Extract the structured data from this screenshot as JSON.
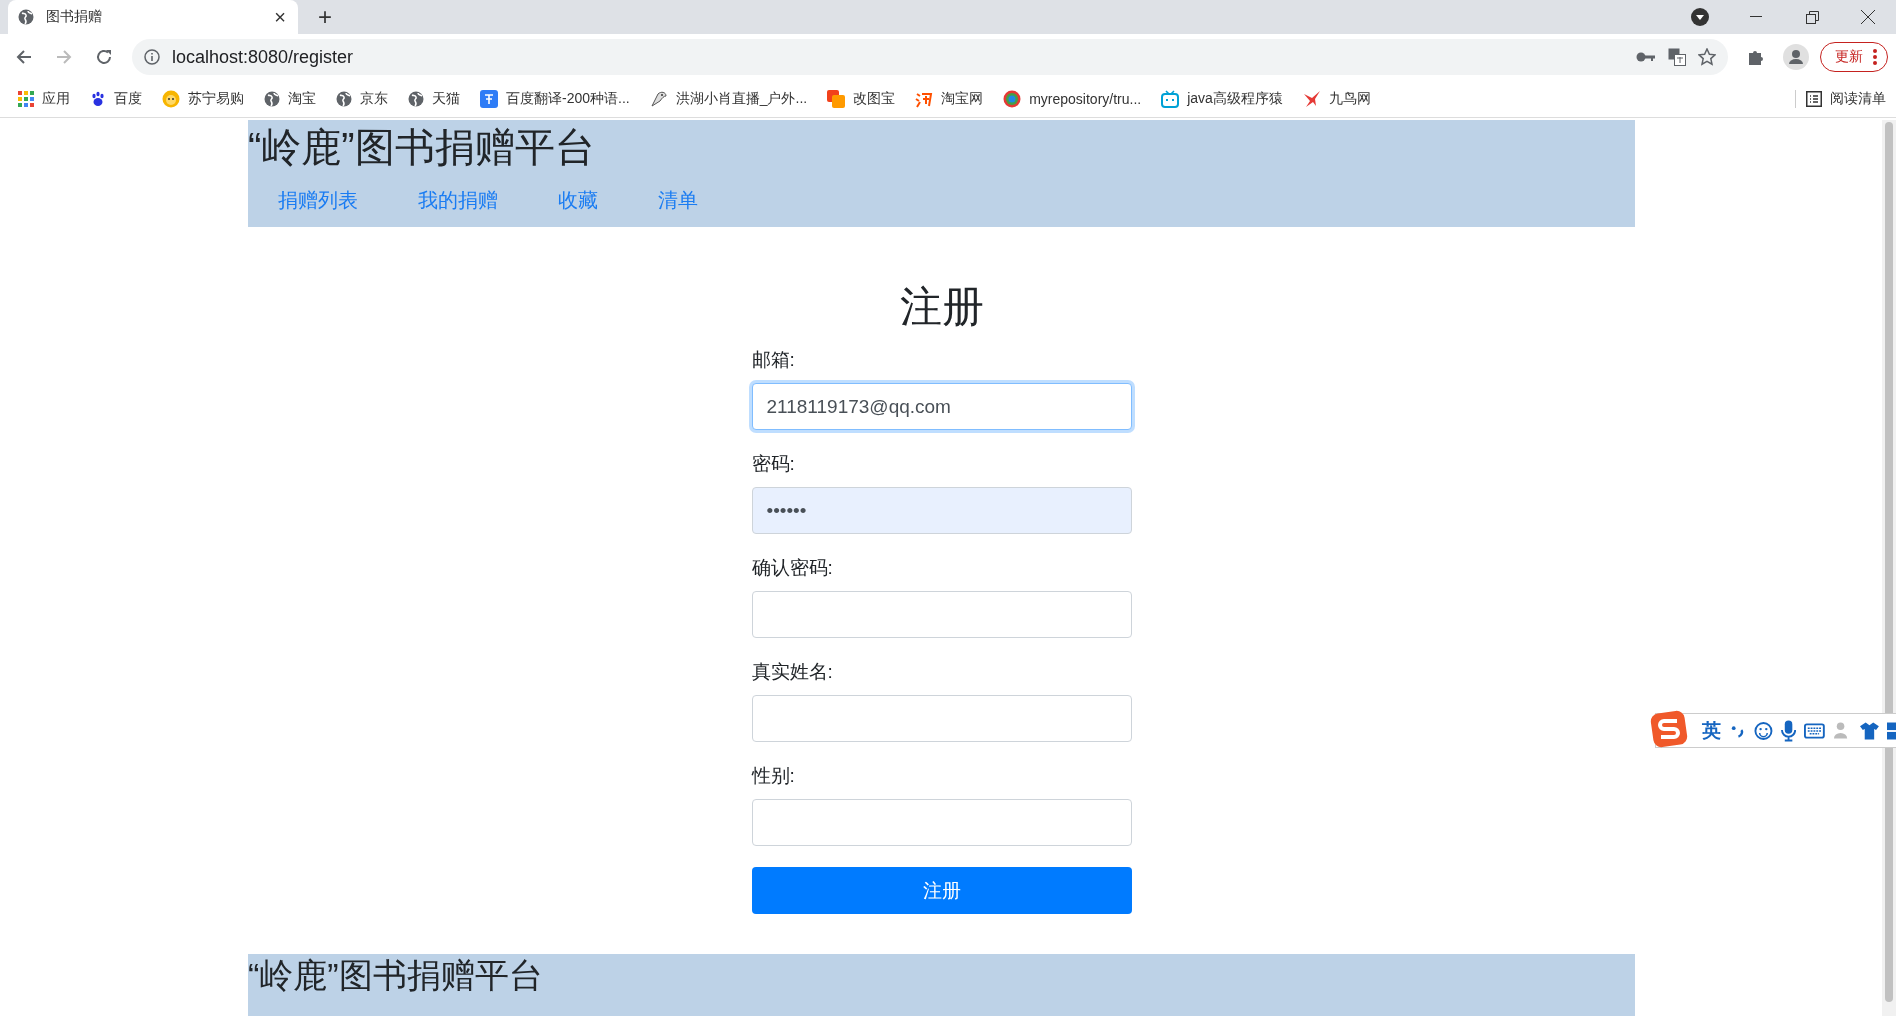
{
  "browser": {
    "tab_title": "图书捐赠",
    "tab_close": "×",
    "new_tab": "+",
    "address": "localhost:8080/register",
    "update_button": "更新",
    "bookmarks": [
      {
        "label": "应用",
        "kind": "apps"
      },
      {
        "label": "百度",
        "kind": "paw"
      },
      {
        "label": "苏宁易购",
        "kind": "lion"
      },
      {
        "label": "淘宝",
        "kind": "globe"
      },
      {
        "label": "京东",
        "kind": "globe"
      },
      {
        "label": "天猫",
        "kind": "globe"
      },
      {
        "label": "百度翻译-200种语...",
        "kind": "translate"
      },
      {
        "label": "洪湖小肖直播_户外...",
        "kind": "bird"
      },
      {
        "label": "改图宝",
        "kind": "squares"
      },
      {
        "label": "淘宝网",
        "kind": "tao"
      },
      {
        "label": "myrepository/tru...",
        "kind": "ring"
      },
      {
        "label": "java高级程序猿",
        "kind": "tv"
      },
      {
        "label": "九鸟网",
        "kind": "swallow"
      }
    ],
    "reading_list": "阅读清单"
  },
  "header": {
    "title": "“岭鹿”图书捐赠平台",
    "nav": [
      "捐赠列表",
      "我的捐赠",
      "收藏",
      "清单"
    ]
  },
  "form": {
    "title": "注册",
    "fields": [
      {
        "label": "邮箱:",
        "value": "2118119173@qq.com",
        "focused": true,
        "autofilled": false
      },
      {
        "label": "密码:",
        "value": "••••••",
        "focused": false,
        "autofilled": true
      },
      {
        "label": "确认密码:",
        "focused": false,
        "autofilled": false
      },
      {
        "label": "真实姓名:",
        "focused": false,
        "autofilled": false
      },
      {
        "label": "性别:",
        "focused": false,
        "autofilled": false
      }
    ],
    "submit": "注册"
  },
  "footer": {
    "title": "“岭鹿”图书捐赠平台"
  },
  "ime": {
    "mode": "英"
  }
}
